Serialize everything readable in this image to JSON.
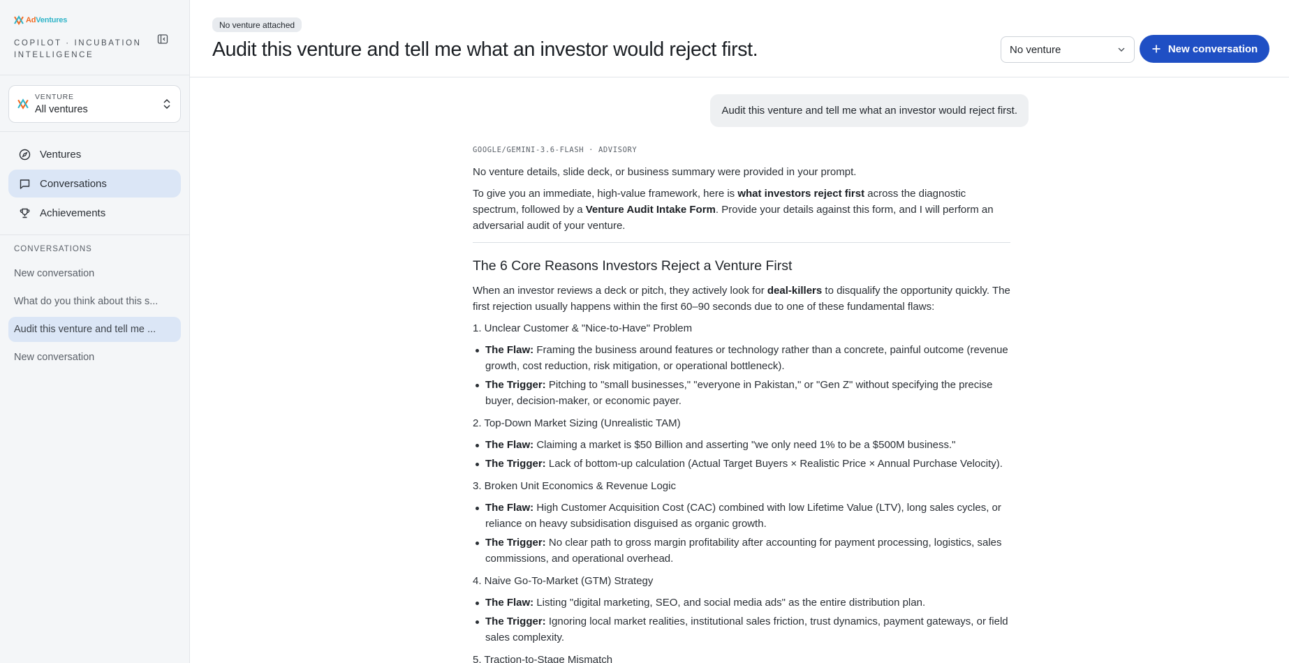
{
  "brand": {
    "part1": "Ad",
    "part2": "Ventures"
  },
  "sidebar": {
    "tagline": "COPILOT · INCUBATION INTELLIGENCE",
    "venture_picker": {
      "label": "VENTURE",
      "value": "All ventures"
    },
    "nav": [
      {
        "label": "Ventures",
        "icon": "compass-icon"
      },
      {
        "label": "Conversations",
        "icon": "chat-bubble-icon"
      },
      {
        "label": "Achievements",
        "icon": "trophy-icon"
      }
    ],
    "conversations_label": "CONVERSATIONS",
    "conversations": [
      {
        "label": "New conversation"
      },
      {
        "label": "What do you think about this s..."
      },
      {
        "label": "Audit this venture and tell me ..."
      },
      {
        "label": "New conversation"
      }
    ]
  },
  "header": {
    "badge": "No venture attached",
    "title": "Audit this venture and tell me what an investor would reject first.",
    "select_value": "No venture",
    "new_button": "New conversation"
  },
  "chat": {
    "user_message": "Audit this venture and tell me what an investor would reject first.",
    "model_tag": "GOOGLE/GEMINI-3.6-FLASH · ADVISORY",
    "intro1": "No venture details, slide deck, or business summary were provided in your prompt.",
    "intro2": {
      "a": "To give you an immediate, high-value framework, here is ",
      "b": "what investors reject first",
      "c": " across the diagnostic spectrum, followed by a ",
      "d": "Venture Audit Intake Form",
      "e": ". Provide your details against this form, and I will perform an adversarial audit of your venture."
    },
    "heading": "The 6 Core Reasons Investors Reject a Venture First",
    "lead": {
      "a": "When an investor reviews a deck or pitch, they actively look for ",
      "b": "deal-killers",
      "c": " to disqualify the opportunity quickly. The first rejection usually happens within the first 60–90 seconds due to one of these fundamental flaws:"
    },
    "flaw_label": "The Flaw:",
    "trigger_label": "The Trigger:",
    "sections": [
      {
        "title": "1. Unclear Customer & \"Nice-to-Have\" Problem",
        "flaw": " Framing the business around features or technology rather than a concrete, painful outcome (revenue growth, cost reduction, risk mitigation, or operational bottleneck).",
        "trigger": " Pitching to \"small businesses,\" \"everyone in Pakistan,\" or \"Gen Z\" without specifying the precise buyer, decision-maker, or economic payer."
      },
      {
        "title": "2. Top-Down Market Sizing (Unrealistic TAM)",
        "flaw": " Claiming a market is $50 Billion and asserting \"we only need 1% to be a $500M business.\"",
        "trigger": " Lack of bottom-up calculation (Actual Target Buyers × Realistic Price × Annual Purchase Velocity)."
      },
      {
        "title": "3. Broken Unit Economics & Revenue Logic",
        "flaw": " High Customer Acquisition Cost (CAC) combined with low Lifetime Value (LTV), long sales cycles, or reliance on heavy subsidisation disguised as organic growth.",
        "trigger": " No clear path to gross margin profitability after accounting for payment processing, logistics, sales commissions, and operational overhead."
      },
      {
        "title": "4. Naive Go-To-Market (GTM) Strategy",
        "flaw": " Listing \"digital marketing, SEO, and social media ads\" as the entire distribution plan.",
        "trigger": " Ignoring local market realities, institutional sales friction, trust dynamics, payment gateways, or field sales complexity."
      },
      {
        "title": "5. Traction-to-Stage Mismatch"
      }
    ]
  },
  "colors": {
    "accent": "#1f4fc4",
    "active_bg": "#dbe6f6",
    "brand_orange": "#f26a21",
    "brand_teal": "#2fb4c8"
  }
}
